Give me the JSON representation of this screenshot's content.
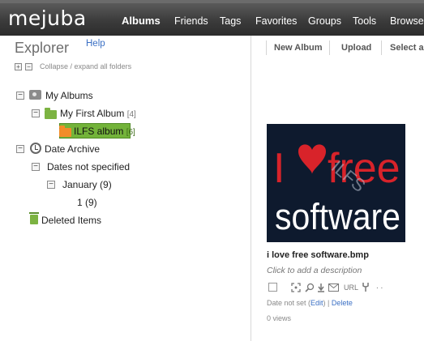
{
  "brand": {
    "logo": "mejuba"
  },
  "nav": {
    "items": [
      {
        "label": "Albums",
        "active": true
      },
      {
        "label": "Friends",
        "active": false
      },
      {
        "label": "Tags",
        "active": false
      },
      {
        "label": "Favorites",
        "active": false
      },
      {
        "label": "Groups",
        "active": false
      },
      {
        "label": "Tools",
        "active": false
      },
      {
        "label": "Browse",
        "active": false
      }
    ]
  },
  "explorer": {
    "title": "Explorer",
    "help": "Help",
    "collapse_expand": "Collapse / expand all folders",
    "toggle_collapsed_symbol": "+",
    "toggle_expanded_symbol": "−",
    "tree": {
      "my_albums": {
        "label": "My Albums",
        "icon": "camera-icon"
      },
      "my_first_album": {
        "label": "My First Album",
        "count": "[4]",
        "icon": "folder-icon",
        "color": "#7cb342"
      },
      "ilfs_album": {
        "label": "ILFS album",
        "count": "[6]",
        "icon": "folder-icon",
        "color": "#f28c28",
        "selected": true
      },
      "date_archive": {
        "label": "Date Archive",
        "icon": "clock-icon"
      },
      "dates_not_specified": {
        "label": "Dates not specified"
      },
      "january": {
        "label": "January (9)"
      },
      "day_one": {
        "label": "1 (9)"
      },
      "deleted_items": {
        "label": "Deleted Items",
        "icon": "trash-icon"
      }
    }
  },
  "toolbar": {
    "new_album": "New Album",
    "upload": "Upload",
    "select_all": "Select al"
  },
  "photo": {
    "filename": "i love free software.bmp",
    "description_placeholder": "Click to add a description",
    "image_text": {
      "line1_prefix": "I",
      "line1_suffix": "free",
      "line2": "software",
      "watermark": "ILFS"
    },
    "actions": {
      "url": "URL",
      "dots": ". ."
    },
    "date_prefix": "Date not set (",
    "edit": "Edit",
    "date_suffix": ") | ",
    "delete": "Delete",
    "views": "0 views"
  },
  "colors": {
    "link": "#3a6fc4",
    "selection_green": "#73b33a",
    "heart_red": "#d8232a",
    "image_background": "#0e1a2e"
  }
}
